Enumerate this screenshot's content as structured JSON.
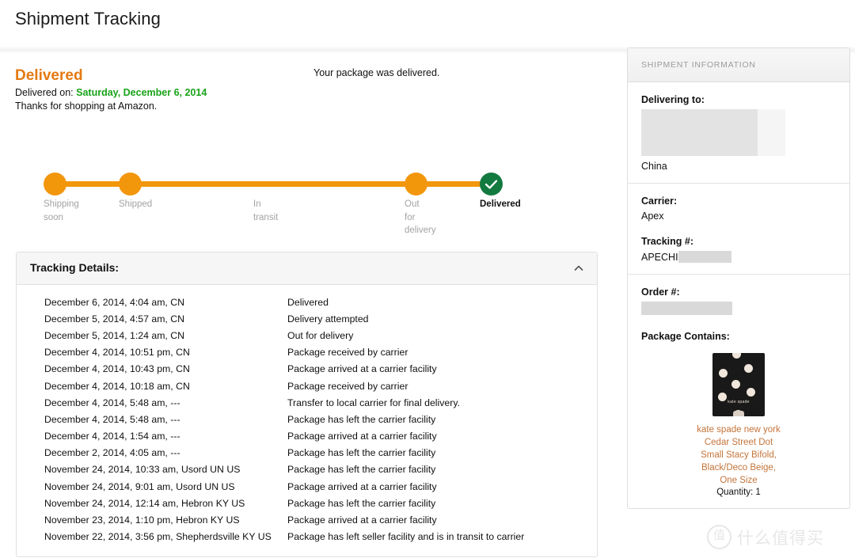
{
  "page": {
    "title": "Shipment Tracking"
  },
  "status": {
    "headline": "Delivered",
    "delivered_on_label": "Delivered on:",
    "delivered_on_date": "Saturday, December 6, 2014",
    "thanks": "Thanks for shopping at Amazon.",
    "package_message": "Your package was delivered.",
    "accent_color": "#E47911",
    "date_color": "#19A319"
  },
  "tracker": {
    "bar_color": "#F2960B",
    "done_color": "#137A3F",
    "steps": [
      {
        "label": "Shipping\nsoon",
        "state": "done",
        "icon": "circle-icon"
      },
      {
        "label": "Shipped",
        "state": "done",
        "icon": "circle-icon"
      },
      {
        "label": "In\ntransit",
        "state": "done",
        "icon": "none"
      },
      {
        "label": "Out\nfor\ndelivery",
        "state": "done",
        "icon": "circle-icon"
      },
      {
        "label": "Delivered",
        "state": "current",
        "icon": "check-circle-icon"
      }
    ]
  },
  "details": {
    "title": "Tracking Details:",
    "collapse_icon": "chevron-up-icon",
    "rows": [
      {
        "when": "December 6, 2014, 4:04 am,   CN",
        "what": "Delivered"
      },
      {
        "when": "December 5, 2014, 4:57 am,   CN",
        "what": "Delivery attempted"
      },
      {
        "when": "December 5, 2014, 1:24 am,   CN",
        "what": "Out for delivery"
      },
      {
        "when": "December 4, 2014, 10:51 pm,   CN",
        "what": "Package received by carrier"
      },
      {
        "when": "December 4, 2014, 10:43 pm,   CN",
        "what": "Package arrived at a carrier facility"
      },
      {
        "when": "December 4, 2014, 10:18 am,   CN",
        "what": "Package received by carrier"
      },
      {
        "when": "December 4, 2014, 5:48 am, ---",
        "what": "Transfer to local carrier for final delivery."
      },
      {
        "when": "December 4, 2014, 5:48 am, ---",
        "what": "Package has left the carrier facility"
      },
      {
        "when": "December 4, 2014, 1:54 am, ---",
        "what": "Package arrived at a carrier facility"
      },
      {
        "when": "December 2, 2014, 4:05 am, ---",
        "what": "Package has left the carrier facility"
      },
      {
        "when": "November 24, 2014, 10:33 am, Usord UN US",
        "what": "Package has left the carrier facility"
      },
      {
        "when": "November 24, 2014, 9:01 am, Usord UN US",
        "what": "Package arrived at a carrier facility"
      },
      {
        "when": "November 24, 2014, 12:14 am, Hebron KY US",
        "what": "Package has left the carrier facility"
      },
      {
        "when": "November 23, 2014, 1:10 pm, Hebron KY US",
        "what": "Package arrived at a carrier facility"
      },
      {
        "when": "November 22, 2014, 3:56 pm, Shepherdsville KY US",
        "what": "Package has left seller facility and is in transit to carrier"
      }
    ]
  },
  "sidebar": {
    "header": "SHIPMENT INFORMATION",
    "delivering_to": {
      "label": "Delivering to:",
      "country": "China"
    },
    "carrier": {
      "label": "Carrier:",
      "value": "Apex"
    },
    "tracking": {
      "label": "Tracking #:",
      "value_prefix": "APECHI"
    },
    "order": {
      "label": "Order #:"
    },
    "package": {
      "label": "Package Contains:",
      "brand": "kate spade new york",
      "description": "Cedar Street Dot\nSmall Stacy Bifold,\nBlack/Deco Beige,\nOne Size",
      "quantity": "Quantity: 1",
      "logo_text": "kate spade",
      "desc_color": "#C4743A"
    }
  },
  "watermark": {
    "mark": "值",
    "text": "什么值得买"
  }
}
